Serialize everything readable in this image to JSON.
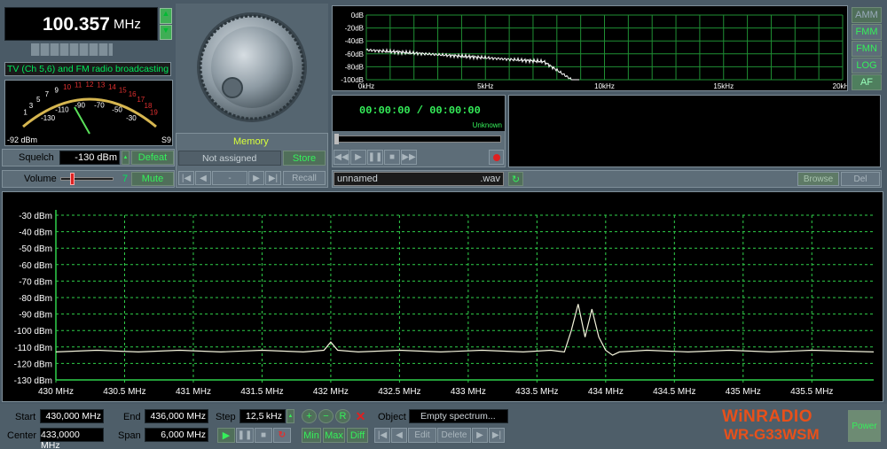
{
  "freq": {
    "value": "100.357",
    "unit": "MHz"
  },
  "band_label": "TV (Ch 5,6) and FM radio broadcasting",
  "smeter": {
    "scale": [
      "1",
      "3",
      "5",
      "7",
      "9",
      "10",
      "11",
      "12",
      "13",
      "14",
      "15",
      "16",
      "17",
      "18",
      "19"
    ],
    "lower": [
      "-130",
      "-110",
      "-90",
      "-70",
      "-50",
      "-30"
    ],
    "reading": "-92",
    "unit": "dBm",
    "s_reading": "S9"
  },
  "squelch": {
    "label": "Squelch",
    "value": "-130 dBm",
    "button": "Defeat"
  },
  "volume": {
    "label": "Volume",
    "value": "7",
    "button": "Mute"
  },
  "memory": {
    "title": "Memory",
    "value": "Not assigned",
    "store": "Store",
    "recall": "Recall",
    "dash": "-"
  },
  "af_spectrum": {
    "y_labels": [
      "0dB",
      "-20dB",
      "-40dB",
      "-60dB",
      "-80dB",
      "-100dB"
    ],
    "x_labels": [
      "0kHz",
      "5kHz",
      "10kHz",
      "15kHz",
      "20kHz"
    ]
  },
  "modes": [
    "AMM",
    "FMM",
    "FMN",
    "LOG",
    "AF"
  ],
  "recorder": {
    "time": "00:00:00 / 00:00:00",
    "status": "Unknown",
    "filename": "unnamed",
    "ext": ".wav",
    "browse": "Browse",
    "del": "Del"
  },
  "chart_data": {
    "type": "line",
    "y_labels": [
      "-30 dBm",
      "-40 dBm",
      "-50 dBm",
      "-60 dBm",
      "-70 dBm",
      "-80 dBm",
      "-90 dBm",
      "-100 dBm",
      "-110 dBm",
      "-120 dBm",
      "-130 dBm"
    ],
    "x_labels": [
      "430 MHz",
      "430.5 MHz",
      "431 MHz",
      "431.5 MHz",
      "432 MHz",
      "432.5 MHz",
      "433 MHz",
      "433.5 MHz",
      "434 MHz",
      "434.5 MHz",
      "435 MHz",
      "435.5 MHz"
    ],
    "ylim": [
      -130,
      -30
    ],
    "xlim": [
      430,
      435.95
    ],
    "grid": true,
    "series": [
      {
        "x": [
          430.0,
          430.3,
          430.6,
          430.9,
          431.2,
          431.5,
          431.8,
          431.95,
          432.0,
          432.05,
          432.2,
          432.5,
          432.8,
          433.1,
          433.4,
          433.6,
          433.7,
          433.75,
          433.8,
          433.85,
          433.9,
          433.95,
          434.0,
          434.05,
          434.1,
          434.3,
          434.6,
          434.9,
          435.2,
          435.5,
          435.95
        ],
        "y": [
          -113,
          -112,
          -113,
          -112,
          -113,
          -112,
          -113,
          -112,
          -107,
          -112,
          -113,
          -112,
          -113,
          -112,
          -113,
          -112,
          -113,
          -100,
          -84,
          -104,
          -87,
          -104,
          -112,
          -115,
          -113,
          -112,
          -113,
          -112,
          -113,
          -112,
          -113
        ]
      }
    ]
  },
  "bottom": {
    "start_label": "Start",
    "start_value": "430,000 MHz",
    "center_label": "Center",
    "center_value": "433,0000 MHz",
    "end_label": "End",
    "end_value": "436,000 MHz",
    "span_label": "Span",
    "span_value": "6,000 MHz",
    "step_label": "Step",
    "step_value": "12,5",
    "step_unit": "kHz",
    "min": "Min",
    "max": "Max",
    "diff": "Diff",
    "object_label": "Object",
    "object_value": "Empty spectrum...",
    "edit": "Edit",
    "delete": "Delete"
  },
  "brand": {
    "name": "WiNRADIO",
    "model": "WR-G33WSM"
  },
  "power": "Power"
}
